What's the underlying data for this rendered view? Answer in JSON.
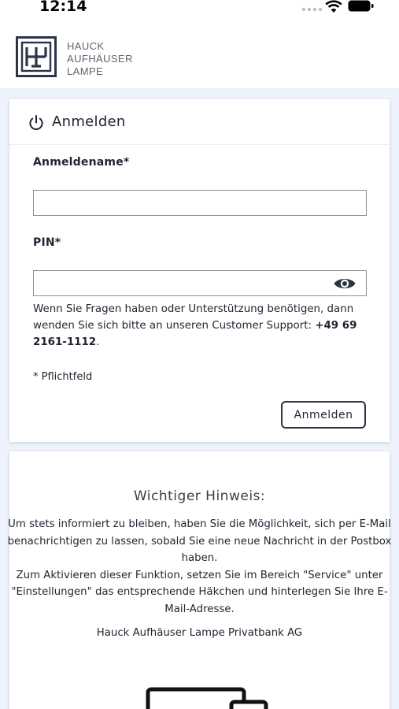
{
  "status_bar": {
    "time": "12:14",
    "icons": [
      "signal-dots-icon",
      "wifi-icon",
      "battery-icon"
    ]
  },
  "header": {
    "logo_icon": "hal-monogram-logo",
    "brand_lines": [
      "HAUCK",
      "AUFHÄUSER",
      "LAMPE"
    ]
  },
  "login": {
    "icon": "power-icon",
    "title": "Anmelden",
    "username_label": "Anmeldename*",
    "username_value": "",
    "pin_label": "PIN*",
    "pin_value": "",
    "pin_toggle_icon": "eye-icon",
    "support_text": "Wenn Sie Fragen haben oder Unterstützung benötigen, dann wenden Sie sich bitte an unseren Customer Support: ",
    "support_phone": "+49 69 2161-1112",
    "support_end": ".",
    "required_note": "* Pflichtfeld",
    "submit_label": "Anmelden"
  },
  "notice": {
    "title": "Wichtiger Hinweis:",
    "paragraph_1": "Um stets informiert zu bleiben, haben Sie die Möglichkeit, sich per E-Mail benachrichtigen zu lassen, sobald Sie eine neue Nachricht in der Postbox haben.",
    "paragraph_2": "Zum Aktivieren dieser Funktion, setzen Sie im Bereich \"Service\" unter \"Einstellungen\" das entsprechende Häkchen und hinterlegen Sie Ihre E-Mail-Adresse.",
    "company": "Hauck Aufhäuser Lampe Privatbank AG",
    "illustration_icon": "devices-icon"
  },
  "colors": {
    "page_background": "#eef3fb",
    "brand_navy": "#2b3547",
    "text": "#1f2430"
  }
}
